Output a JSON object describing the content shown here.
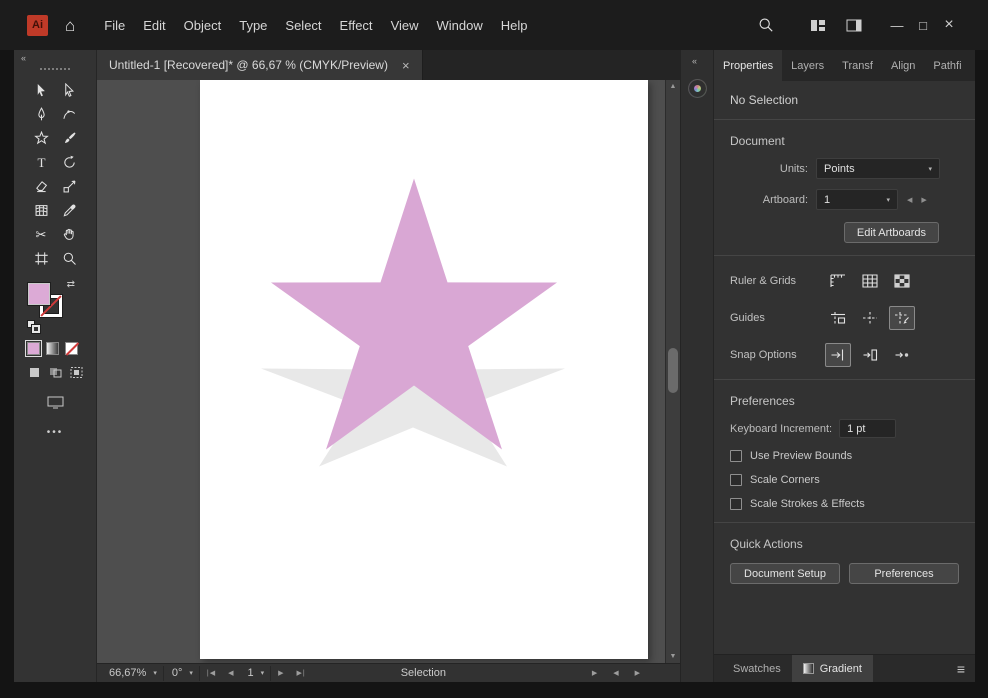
{
  "window": {
    "logo": "Ai",
    "menus": [
      "File",
      "Edit",
      "Object",
      "Type",
      "Select",
      "Effect",
      "View",
      "Window",
      "Help"
    ],
    "controls": {
      "minimize": "—",
      "maximize": "□",
      "close": "×"
    }
  },
  "doc_tab": {
    "title": "Untitled-1 [Recovered]* @ 66,67 % (CMYK/Preview)"
  },
  "panel": {
    "tabs": [
      "Properties",
      "Layers",
      "Transf",
      "Align",
      "Pathfi"
    ],
    "no_selection": "No Selection",
    "document": {
      "heading": "Document",
      "units_label": "Units:",
      "units_value": "Points",
      "artboard_label": "Artboard:",
      "artboard_value": "1",
      "edit_artboards_button": "Edit Artboards",
      "ruler_grids_label": "Ruler & Grids",
      "guides_label": "Guides",
      "snap_label": "Snap Options"
    },
    "preferences": {
      "heading": "Preferences",
      "keyboard_increment_label": "Keyboard Increment:",
      "keyboard_increment_value": "1 pt",
      "checkbox_labels": [
        "Use Preview Bounds",
        "Scale Corners",
        "Scale Strokes & Effects"
      ]
    },
    "quick_actions": {
      "heading": "Quick Actions",
      "document_setup_button": "Document Setup",
      "preferences_button": "Preferences"
    },
    "bottom_tabs": {
      "swatches": "Swatches",
      "gradient": "Gradient"
    }
  },
  "statusbar": {
    "zoom": "66,67%",
    "rotation": "0°",
    "artboard": "1",
    "tool_label": "Selection"
  },
  "canvas": {
    "star_fill": "#d9a7d4",
    "ghost_star_fill": "#e8e8e8",
    "fill_swatch": "#dcaad6"
  },
  "glyphs": {
    "collapse_left": "«",
    "home": "⌂",
    "chevron_down": "▾",
    "nav_first": "|◀",
    "nav_prev": "◀",
    "nav_next": "▶",
    "nav_last": "▶|",
    "scroll_up": "▲",
    "scroll_down": "▼",
    "swap": "⇄",
    "ellipsis": "•••",
    "menu": "≡",
    "pager_prev": "◀",
    "pager_next": "▶",
    "status_more": "▶",
    "hscroll_left": "◀",
    "hscroll_right": "▶",
    "scissors": "✂",
    "type_tool": "T",
    "tab_close": "×"
  }
}
